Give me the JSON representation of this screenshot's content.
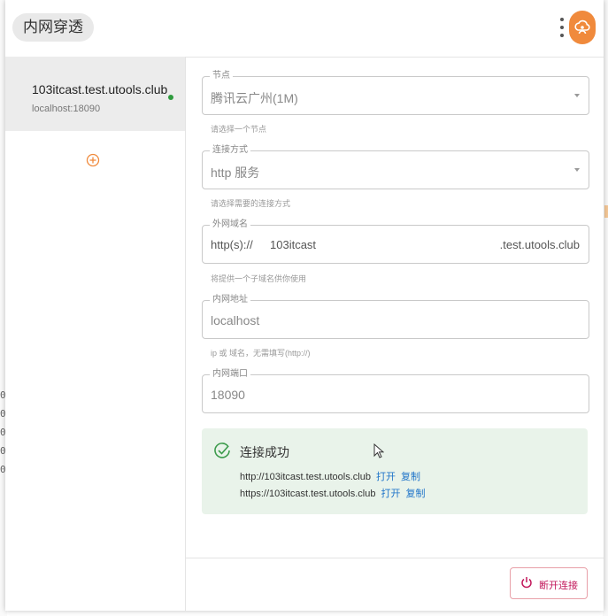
{
  "header": {
    "title": "内网穿透",
    "avatar_icon": "cloud-user-icon",
    "avatar_color": "#f08a3c"
  },
  "sidebar": {
    "tunnel": {
      "name": "103itcast.test.utools.club",
      "target": "localhost:18090",
      "status_color": "#2e9b3e"
    },
    "add_icon": "plus-circle-icon"
  },
  "form": {
    "node": {
      "legend": "节点",
      "value": "腾讯云广州(1M)",
      "helper": "请选择一个节点"
    },
    "method": {
      "legend": "连接方式",
      "value": "http 服务",
      "helper": "请选择需要的连接方式"
    },
    "domain": {
      "legend": "外网域名",
      "prefix": "http(s)://",
      "value": "103itcast",
      "suffix": ".test.utools.club",
      "helper": "将提供一个子域名供你使用"
    },
    "address": {
      "legend": "内网地址",
      "value": "localhost",
      "helper": "ip 或 域名，无需填写(http://)"
    },
    "port": {
      "legend": "内网端口",
      "value": "18090"
    }
  },
  "success": {
    "title": "连接成功",
    "urls": [
      {
        "url": "http://103itcast.test.utools.club",
        "open": "打开",
        "copy": "复制"
      },
      {
        "url": "https://103itcast.test.utools.club",
        "open": "打开",
        "copy": "复制"
      }
    ],
    "accent": "#1f74c9"
  },
  "footer": {
    "disconnect_label": "断开连接",
    "disconnect_color": "#c2185b"
  },
  "background": {
    "numbers": [
      "0",
      "0",
      "0",
      "0",
      "0"
    ]
  }
}
